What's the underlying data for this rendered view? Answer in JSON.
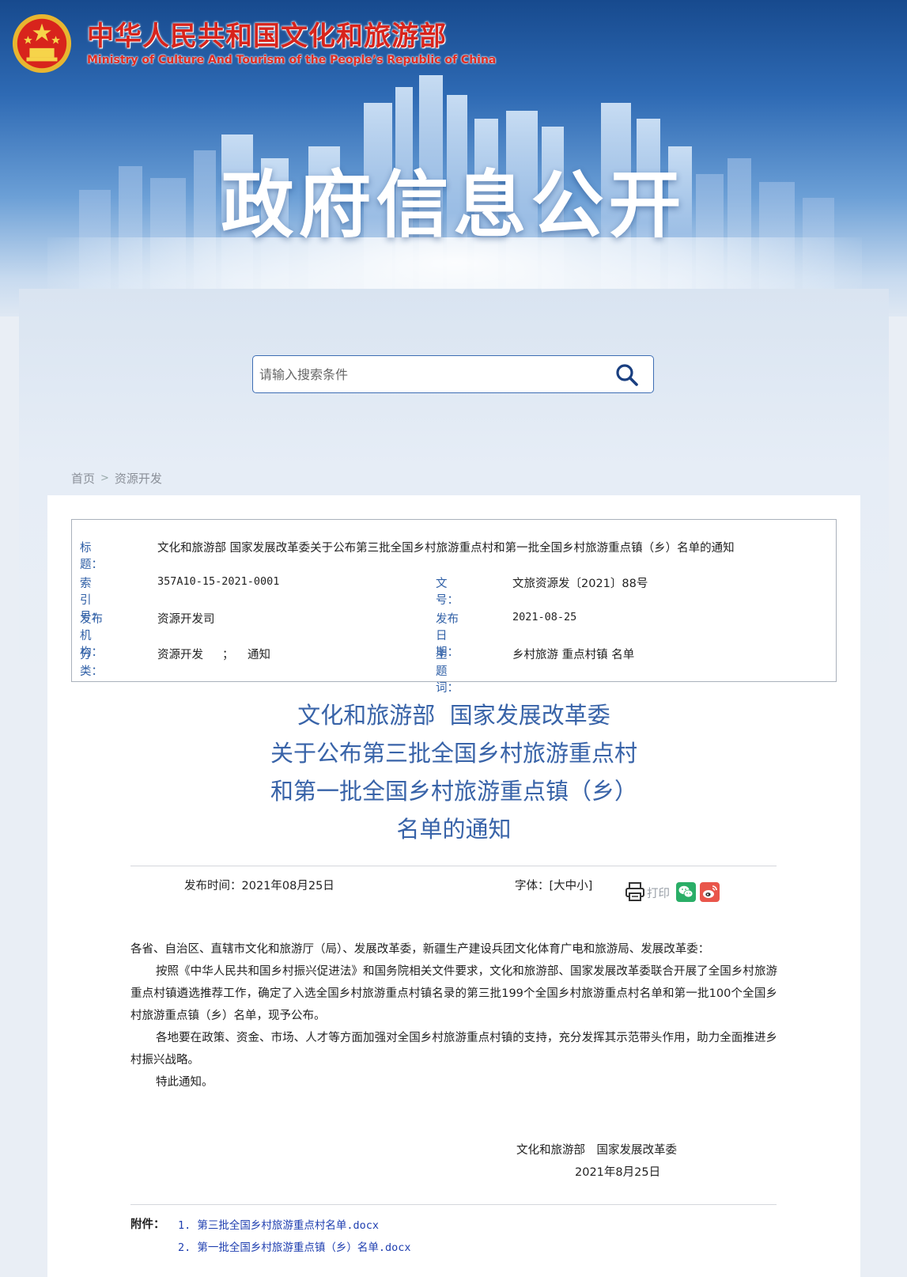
{
  "header": {
    "site_name_cn": "中华人民共和国文化和旅游部",
    "site_name_en": "Ministry of Culture And Tourism of the People’s Republic of China",
    "banner_title": "政府信息公开"
  },
  "search": {
    "placeholder": "请输入搜索条件"
  },
  "breadcrumb": {
    "home": "首页",
    "separator": ">",
    "current": "资源开发"
  },
  "meta": {
    "title_label": "标　　题：",
    "title_value": "文化和旅游部 国家发展改革委关于公布第三批全国乡村旅游重点村和第一批全国乡村旅游重点镇（乡）名单的通知",
    "index_label": "索 引 号：",
    "index_value": "357A10-15-2021-0001",
    "docno_label": "文　　号：",
    "docno_value": "文旅资源发〔2021〕88号",
    "org_label": "发布机构：",
    "org_value": "资源开发司",
    "date_label": "发布日期：",
    "date_value": "2021-08-25",
    "category_label": "分　　类：",
    "category_value1": "资源开发",
    "category_sep": "；",
    "category_value2": "通知",
    "keywords_label": "主 题 词：",
    "keywords_value": "乡村旅游 重点村镇 名单"
  },
  "doc_title": {
    "line1": "文化和旅游部  国家发展改革委",
    "line2": "关于公布第三批全国乡村旅游重点村",
    "line3": "和第一批全国乡村旅游重点镇（乡）",
    "line4": "名单的通知"
  },
  "toolbar": {
    "publish_time": "发布时间：2021年08月25日",
    "font_label": "字体：",
    "font_sizes": "[大中小]",
    "print_label": "打印"
  },
  "body": {
    "salutation": "各省、自治区、直辖市文化和旅游厅（局）、发展改革委，新疆生产建设兵团文化体育广电和旅游局、发展改革委：",
    "para1": "按照《中华人民共和国乡村振兴促进法》和国务院相关文件要求，文化和旅游部、国家发展改革委联合开展了全国乡村旅游重点村镇遴选推荐工作，确定了入选全国乡村旅游重点村镇名录的第三批199个全国乡村旅游重点村名单和第一批100个全国乡村旅游重点镇（乡）名单，现予公布。",
    "para2": "各地要在政策、资金、市场、人才等方面加强对全国乡村旅游重点村镇的支持，充分发挥其示范带头作用，助力全面推进乡村振兴战略。",
    "para3": "特此通知。",
    "signatory": "文化和旅游部　国家发展改革委",
    "sign_date": "2021年8月25日"
  },
  "attachments": {
    "label": "附件：",
    "items": [
      "1. 第三批全国乡村旅游重点村名单.docx",
      "2. 第一批全国乡村旅游重点镇（乡）名单.docx"
    ]
  },
  "colors": {
    "accent_blue": "#3863a8",
    "label_blue": "#2f5fa6",
    "brand_red": "#d8241c",
    "link_blue": "#1f3fb0"
  },
  "icons": [
    "national-emblem",
    "search-icon",
    "print-icon",
    "wechat-icon",
    "weibo-icon"
  ]
}
